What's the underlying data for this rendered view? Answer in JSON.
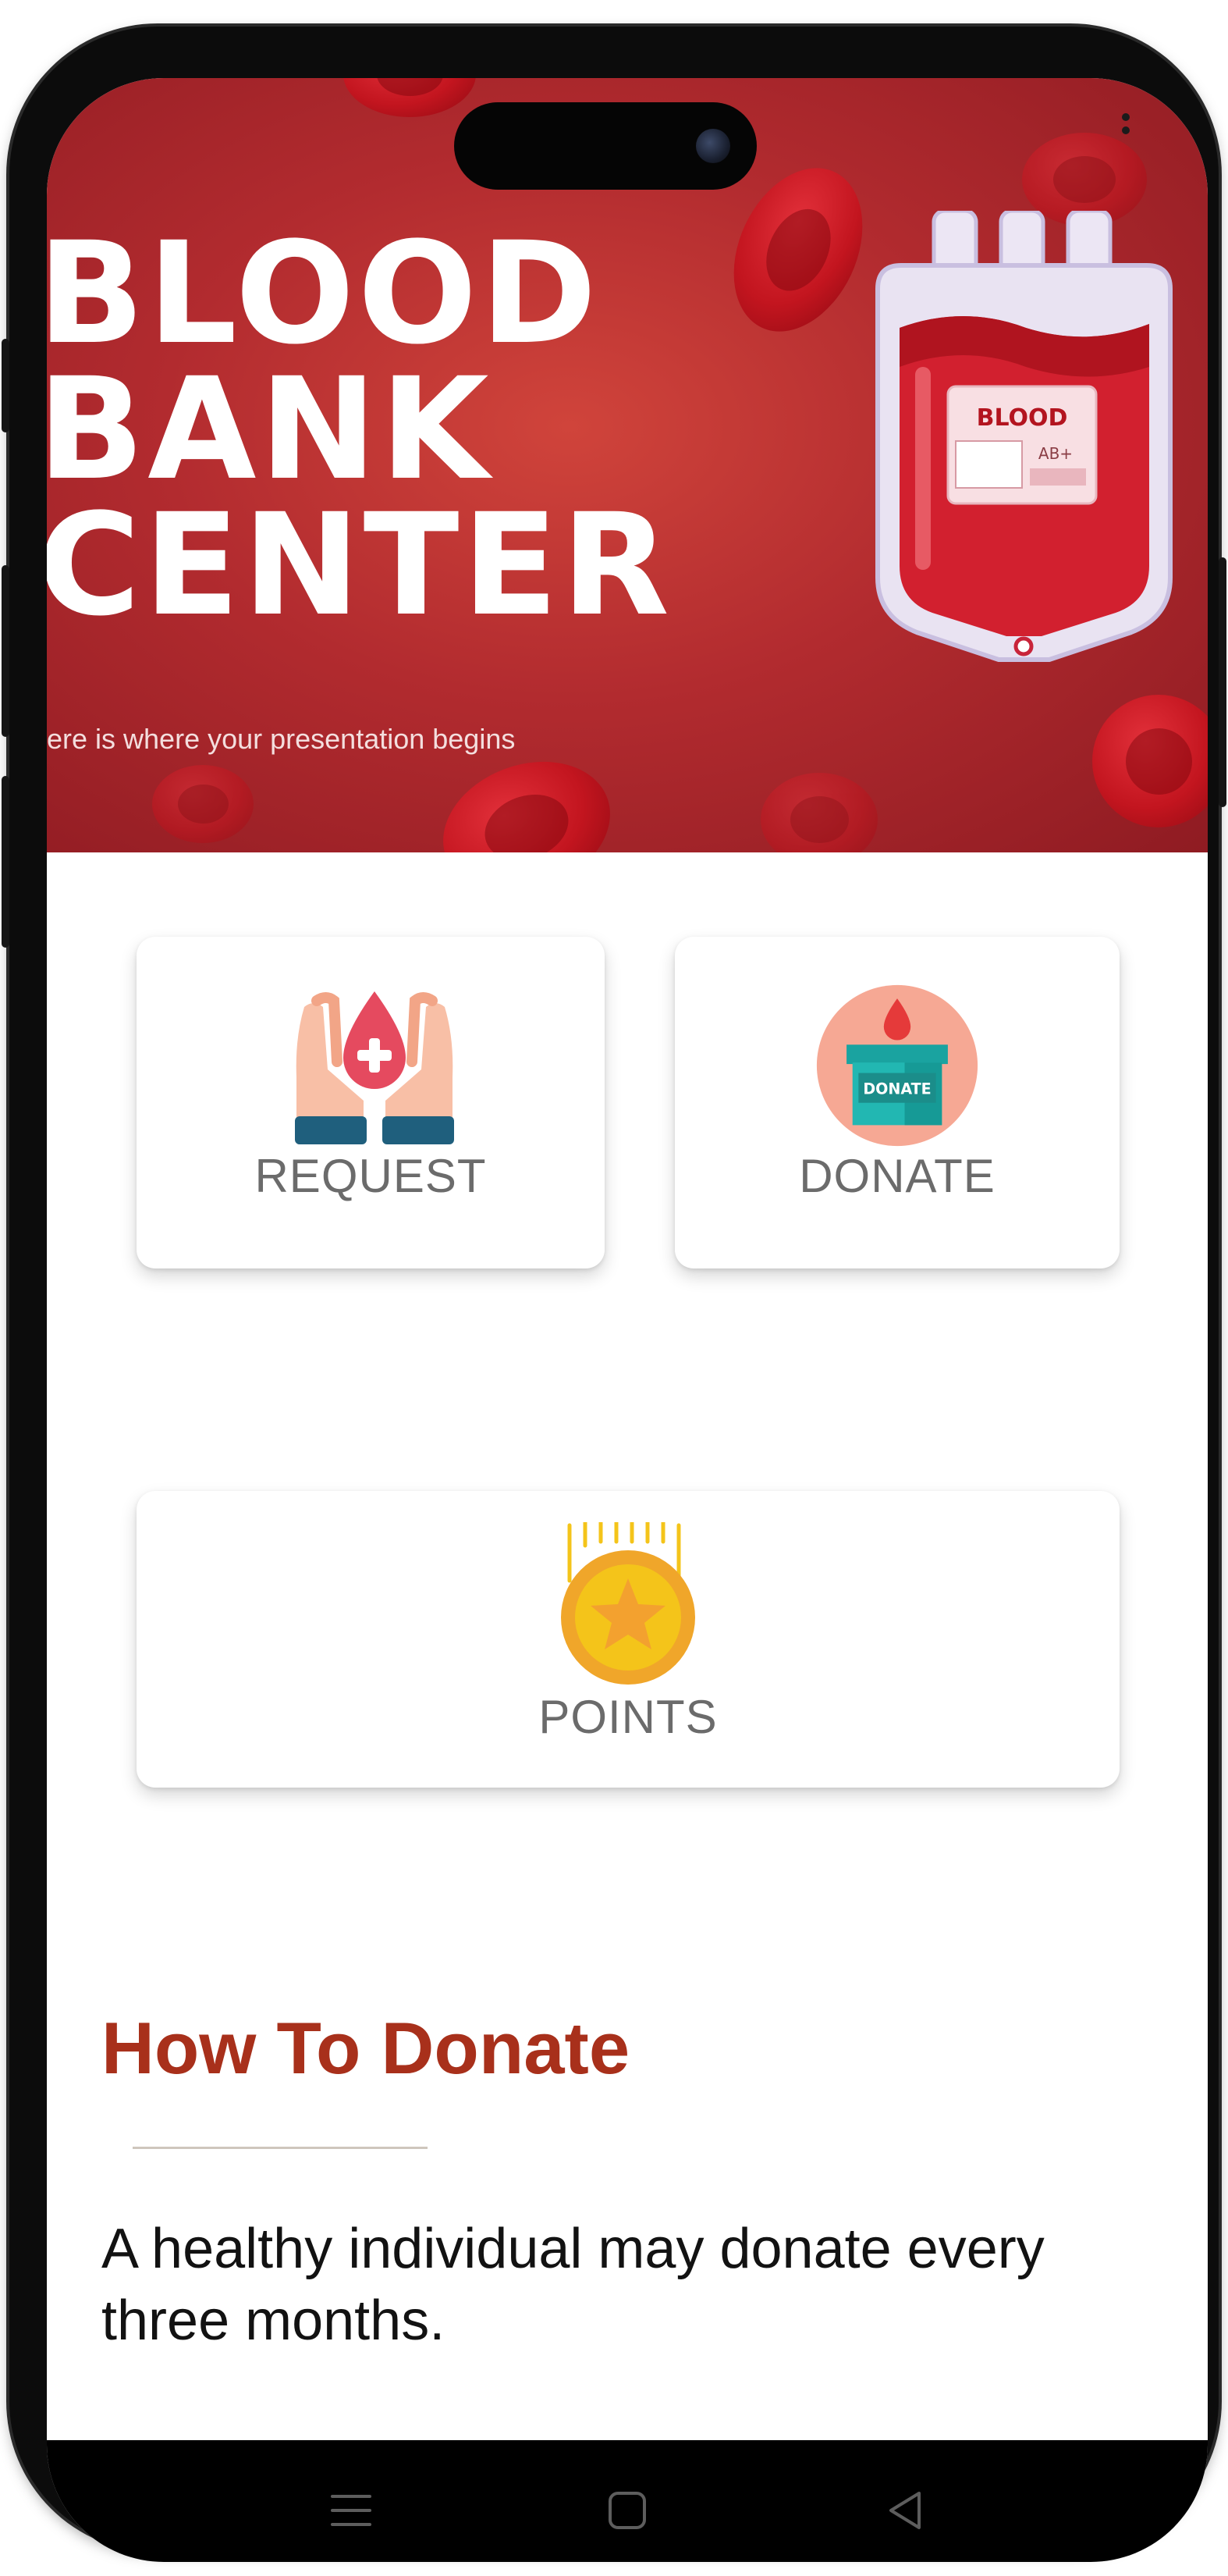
{
  "banner": {
    "title_line1": "BLOOD",
    "title_line2": "BANK",
    "title_line3": "CENTER",
    "subtitle": "ere is where your presentation begins",
    "bag_label": "BLOOD",
    "bag_type": "AB+"
  },
  "menu": {
    "request_label": "REQUEST",
    "donate_label": "DONATE",
    "donate_box_text": "DONATE",
    "points_label": "POINTS"
  },
  "how_to_donate": {
    "title": "How To Donate",
    "body": "A healthy individual may donate every three months."
  },
  "colors": {
    "brand_red": "#b22b2f",
    "title_red": "#a8301b",
    "label_gray": "#6b6b6b"
  },
  "icons": {
    "request": "hands-blood-drop-icon",
    "donate": "donation-box-icon",
    "points": "star-coin-icon",
    "nav_menu": "menu-lines-icon",
    "nav_home": "square-home-icon",
    "nav_back": "triangle-back-icon"
  }
}
